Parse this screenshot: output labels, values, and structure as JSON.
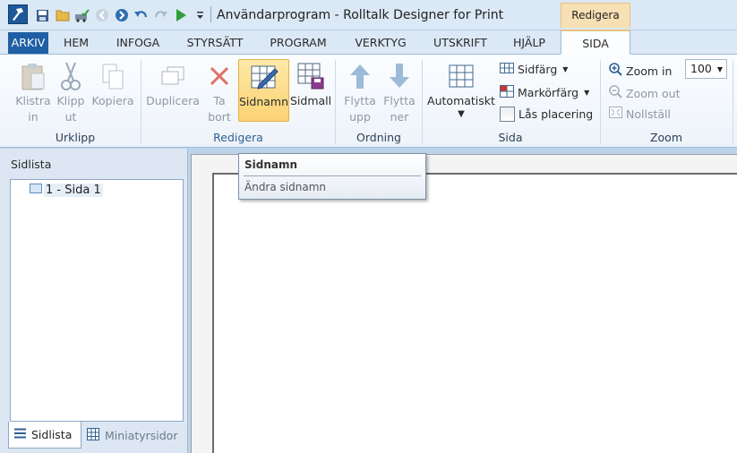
{
  "window": {
    "title": "Användarprogram - Rolltalk Designer for Print",
    "context_tab_title": "Redigera"
  },
  "tabs": [
    {
      "label": "ARKIV"
    },
    {
      "label": "HEM"
    },
    {
      "label": "INFOGA"
    },
    {
      "label": "STYRSÄTT"
    },
    {
      "label": "PROGRAM"
    },
    {
      "label": "VERKTYG"
    },
    {
      "label": "UTSKRIFT"
    },
    {
      "label": "HJÄLP"
    },
    {
      "label": "SIDA"
    }
  ],
  "ribbon": {
    "urklipp": {
      "group_label": "Urklipp",
      "paste": "Klistra\nin",
      "cut": "Klipp\nut",
      "copy": "Kopiera"
    },
    "redigera": {
      "group_label": "Redigera",
      "duplicate": "Duplicera",
      "delete": "Ta\nbort",
      "page_name": "Sidnamn",
      "page_template": "Sidmall"
    },
    "ordning": {
      "group_label": "Ordning",
      "move_up": "Flytta\nupp",
      "move_down": "Flytta\nner"
    },
    "sida": {
      "group_label": "Sida",
      "automatic": "Automatiskt",
      "page_color": "Sidfärg",
      "marker_color": "Markörfärg",
      "lock_placement": "Lås placering"
    },
    "zoom": {
      "group_label": "Zoom",
      "zoom_in": "Zoom in",
      "zoom_out": "Zoom out",
      "reset": "Nollställ",
      "zoom_value": "100"
    }
  },
  "sidebar": {
    "title": "Sidlista",
    "pages": [
      {
        "label": "1 - Sida 1"
      }
    ],
    "tabs": [
      {
        "label": "Sidlista"
      },
      {
        "label": "Miniatyrsidor"
      }
    ]
  },
  "tooltip": {
    "title": "Sidnamn",
    "description": "Ändra sidnamn"
  },
  "colors": {
    "accent": "#1f5fa3",
    "context_tab": "#f6e0b4",
    "selected_button": "#fcd374"
  }
}
